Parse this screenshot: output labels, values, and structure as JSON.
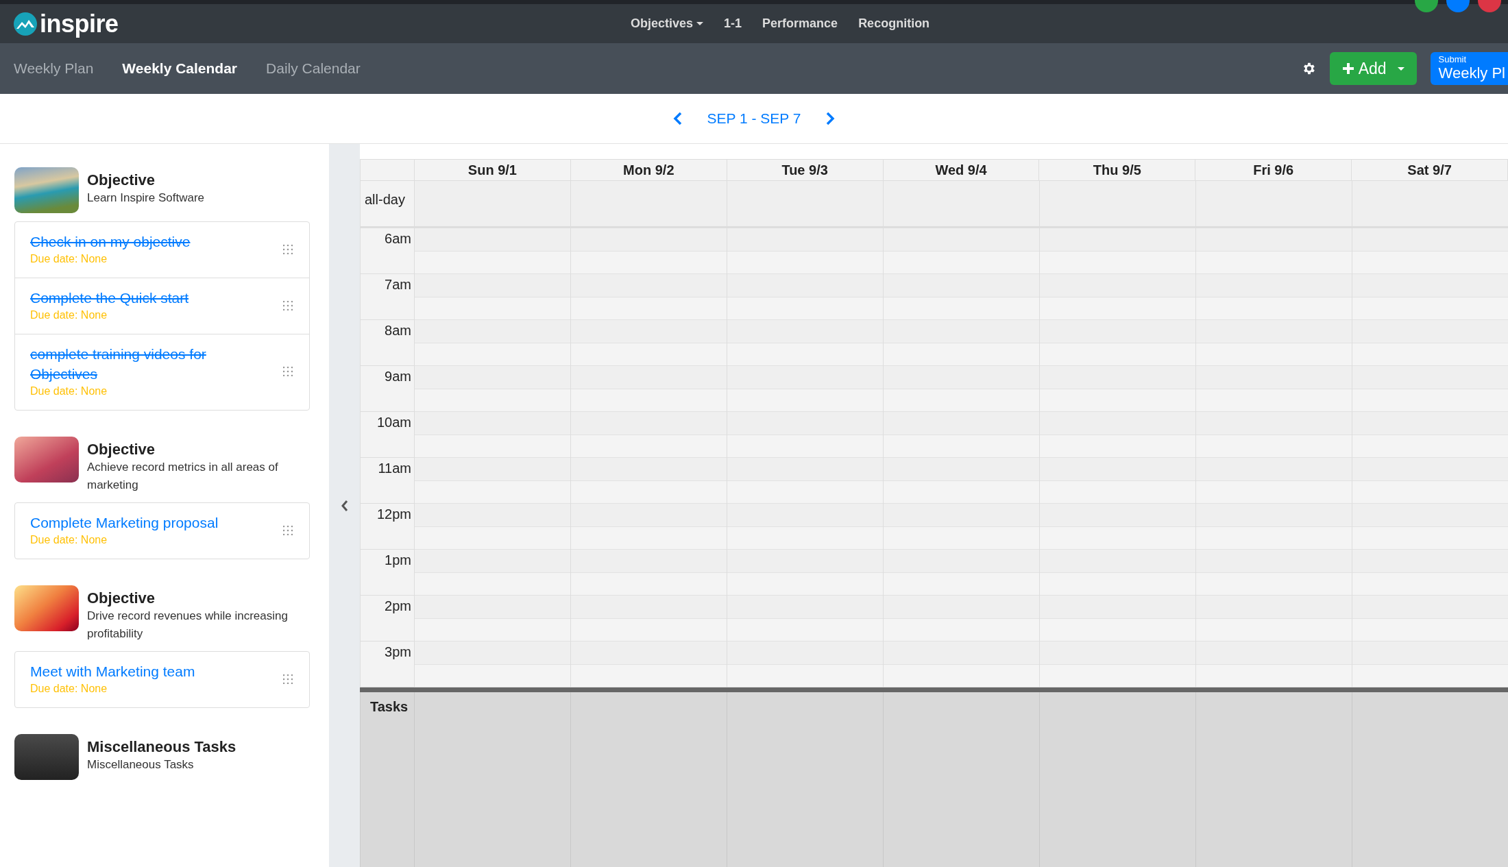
{
  "brand": {
    "name": "inspire"
  },
  "nav": [
    {
      "label": "Objectives",
      "dropdown": true
    },
    {
      "label": "1-1",
      "dropdown": false
    },
    {
      "label": "Performance",
      "dropdown": false
    },
    {
      "label": "Recognition",
      "dropdown": false
    }
  ],
  "avatars": [
    {
      "color": "#28a745"
    },
    {
      "color": "#007bff"
    },
    {
      "color": "#dc3545"
    }
  ],
  "tabs": [
    {
      "label": "Weekly Plan",
      "selected": false
    },
    {
      "label": "Weekly Calendar",
      "selected": true
    },
    {
      "label": "Daily Calendar",
      "selected": false
    }
  ],
  "actions": {
    "add": "Add",
    "submit_caption": "Submit",
    "submit_label": "Weekly Pl"
  },
  "date_range": "SEP 1 - SEP 7",
  "objectives": [
    {
      "title": "Objective",
      "subtitle": "Learn Inspire Software",
      "tasks": [
        {
          "title": "Check in on my objective",
          "done": true,
          "due": "Due date: None"
        },
        {
          "title": "Complete the Quick start",
          "done": true,
          "due": "Due date: None"
        },
        {
          "title": "complete training videos for Objectives",
          "done": true,
          "due": "Due date: None"
        }
      ]
    },
    {
      "title": "Objective",
      "subtitle": "Achieve record metrics in all areas of marketing",
      "tasks": [
        {
          "title": "Complete Marketing proposal",
          "done": false,
          "due": "Due date: None"
        }
      ]
    },
    {
      "title": "Objective",
      "subtitle": "Drive record revenues while increasing profitability",
      "tasks": [
        {
          "title": "Meet with Marketing team",
          "done": false,
          "due": "Due date: None"
        }
      ]
    },
    {
      "title": "Miscellaneous Tasks",
      "subtitle": "Miscellaneous Tasks"
    }
  ],
  "calendar": {
    "days": [
      "Sun 9/1",
      "Mon 9/2",
      "Tue 9/3",
      "Wed 9/4",
      "Thu 9/5",
      "Fri 9/6",
      "Sat 9/7"
    ],
    "all_day_label": "all-day",
    "hours": [
      "6am",
      "7am",
      "8am",
      "9am",
      "10am",
      "11am",
      "12pm",
      "1pm",
      "2pm",
      "3pm"
    ],
    "tasks_label": "Tasks"
  }
}
